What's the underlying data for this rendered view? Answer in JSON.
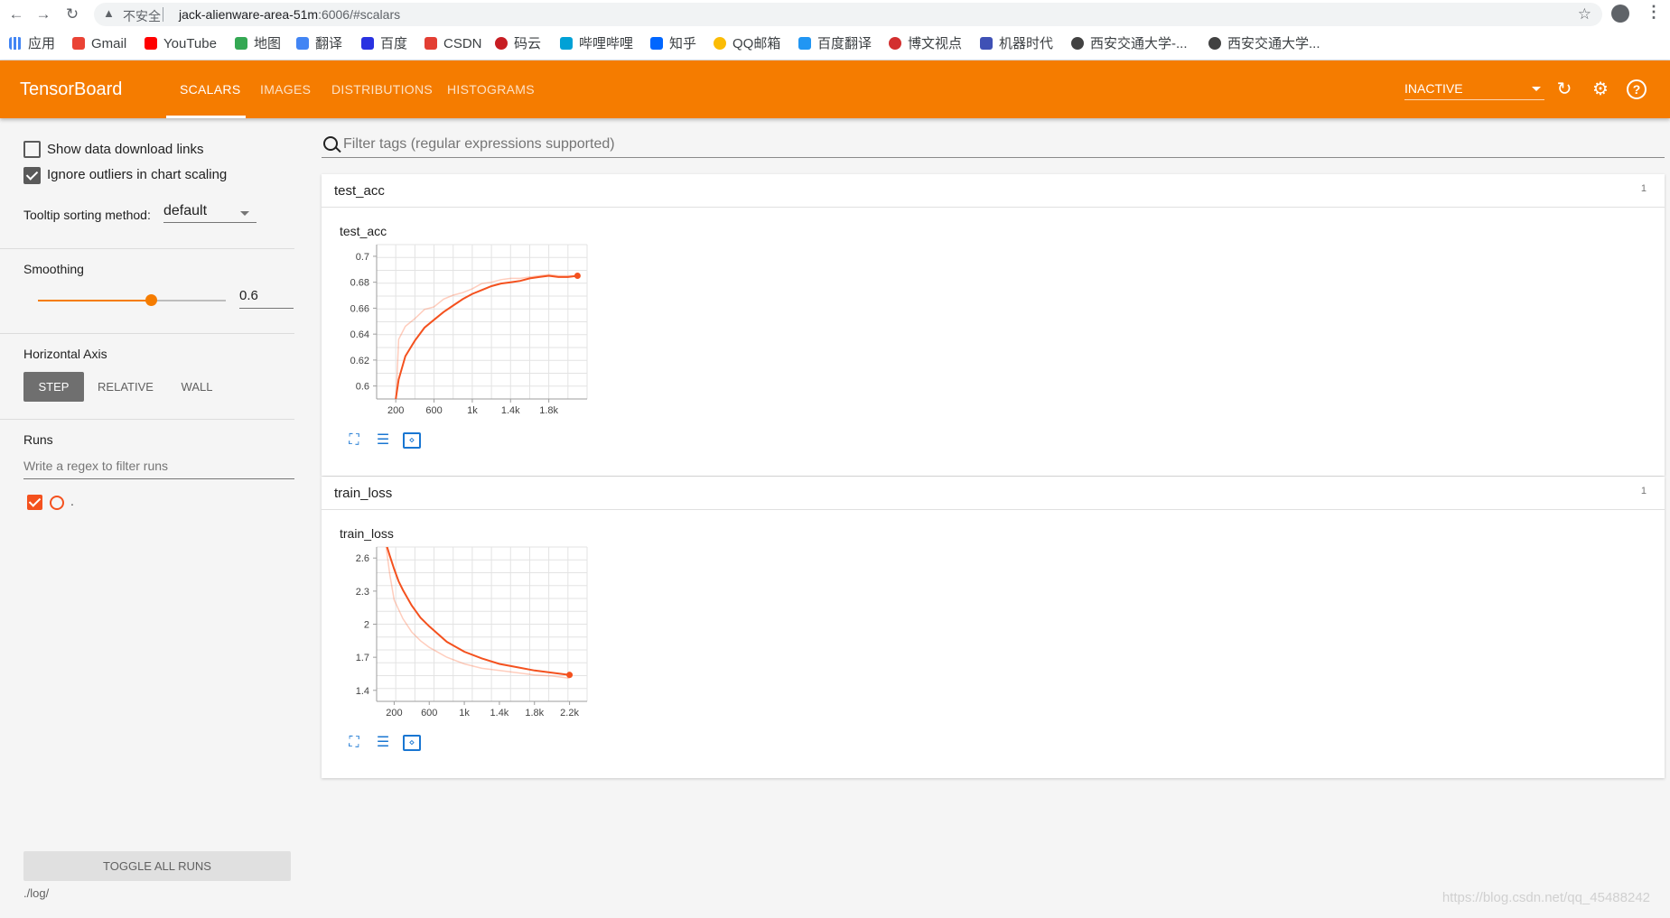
{
  "browser": {
    "insecure_label": "不安全",
    "url_host": "jack-alienware-area-51m",
    "url_rest": ":6006/#scalars",
    "bookmarks": [
      "应用",
      "Gmail",
      "YouTube",
      "地图",
      "翻译",
      "百度",
      "CSDN",
      "码云",
      "哔哩哔哩",
      "知乎",
      "QQ邮箱",
      "百度翻译",
      "博文视点",
      "机器时代",
      "西安交通大学-...",
      "西安交通大学..."
    ]
  },
  "header": {
    "title": "TensorBoard",
    "tabs": [
      "SCALARS",
      "IMAGES",
      "DISTRIBUTIONS",
      "HISTOGRAMS"
    ],
    "active_tab": "SCALARS",
    "status_select": "INACTIVE",
    "color": "#f57c00"
  },
  "sidebar": {
    "show_download_links": "Show data download links",
    "ignore_outliers": "Ignore outliers in chart scaling",
    "tooltip_label": "Tooltip sorting method:",
    "tooltip_value": "default",
    "smoothing_label": "Smoothing",
    "smoothing_value": "0.6",
    "smoothing_fraction": 0.6,
    "horizontal_axis_label": "Horizontal Axis",
    "axis_options": [
      "STEP",
      "RELATIVE",
      "WALL"
    ],
    "runs_label": "Runs",
    "runs_filter_placeholder": "Write a regex to filter runs",
    "run_name": ".",
    "toggle_all": "TOGGLE ALL RUNS",
    "logdir": "./log/"
  },
  "main": {
    "filter_placeholder": "Filter tags (regular expressions supported)",
    "cards": [
      {
        "tag": "test_acc",
        "count": "1",
        "chart_title": "test_acc"
      },
      {
        "tag": "train_loss",
        "count": "1",
        "chart_title": "train_loss"
      }
    ]
  },
  "watermark": "https://blog.csdn.net/qq_45488242",
  "chart_data": [
    {
      "type": "line",
      "title": "test_acc",
      "xlabel": "",
      "ylabel": "",
      "xticks": [
        "200",
        "600",
        "1k",
        "1.4k",
        "1.8k"
      ],
      "yticks": [
        "0.6",
        "0.62",
        "0.64",
        "0.66",
        "0.68",
        "0.7"
      ],
      "xlim": [
        0,
        2200
      ],
      "ylim": [
        0.59,
        0.709
      ],
      "series": [
        {
          "color": "#ff7043",
          "opacity": 0.35,
          "x": [
            200,
            230,
            300,
            400,
            500,
            600,
            700,
            800,
            900,
            1000,
            1100,
            1200,
            1300,
            1400,
            1500,
            1600,
            1700,
            1800,
            1900,
            2000,
            2100
          ],
          "y": [
            0.585,
            0.636,
            0.646,
            0.652,
            0.659,
            0.661,
            0.667,
            0.67,
            0.672,
            0.675,
            0.679,
            0.68,
            0.682,
            0.683,
            0.683,
            0.684,
            0.685,
            0.686,
            0.685,
            0.685,
            0.685
          ]
        },
        {
          "color": "#f4511e",
          "opacity": 1,
          "x": [
            200,
            230,
            300,
            400,
            500,
            600,
            700,
            800,
            900,
            1000,
            1100,
            1200,
            1300,
            1400,
            1500,
            1600,
            1700,
            1800,
            1900,
            2000,
            2100
          ],
          "y": [
            0.59,
            0.605,
            0.623,
            0.635,
            0.645,
            0.651,
            0.657,
            0.662,
            0.667,
            0.671,
            0.674,
            0.677,
            0.679,
            0.68,
            0.681,
            0.683,
            0.684,
            0.685,
            0.684,
            0.684,
            0.685
          ]
        }
      ]
    },
    {
      "type": "line",
      "title": "train_loss",
      "xlabel": "",
      "ylabel": "",
      "xticks": [
        "200",
        "600",
        "1k",
        "1.4k",
        "1.8k",
        "2.2k"
      ],
      "yticks": [
        "1.4",
        "1.7",
        "2",
        "2.3",
        "2.6"
      ],
      "xlim": [
        0,
        2400
      ],
      "ylim": [
        1.3,
        2.7
      ],
      "series": [
        {
          "color": "#ff7043",
          "opacity": 0.35,
          "x": [
            100,
            150,
            200,
            300,
            400,
            500,
            600,
            800,
            1000,
            1200,
            1400,
            1600,
            1800,
            2000,
            2200
          ],
          "y": [
            2.75,
            2.45,
            2.22,
            2.05,
            1.93,
            1.85,
            1.79,
            1.7,
            1.64,
            1.6,
            1.58,
            1.56,
            1.54,
            1.53,
            1.51
          ]
        },
        {
          "color": "#f4511e",
          "opacity": 1,
          "x": [
            100,
            150,
            200,
            250,
            300,
            400,
            500,
            600,
            800,
            1000,
            1200,
            1400,
            1600,
            1800,
            2000,
            2200
          ],
          "y": [
            2.75,
            2.62,
            2.5,
            2.39,
            2.31,
            2.17,
            2.06,
            1.98,
            1.84,
            1.75,
            1.69,
            1.64,
            1.61,
            1.58,
            1.56,
            1.54
          ]
        }
      ]
    }
  ]
}
